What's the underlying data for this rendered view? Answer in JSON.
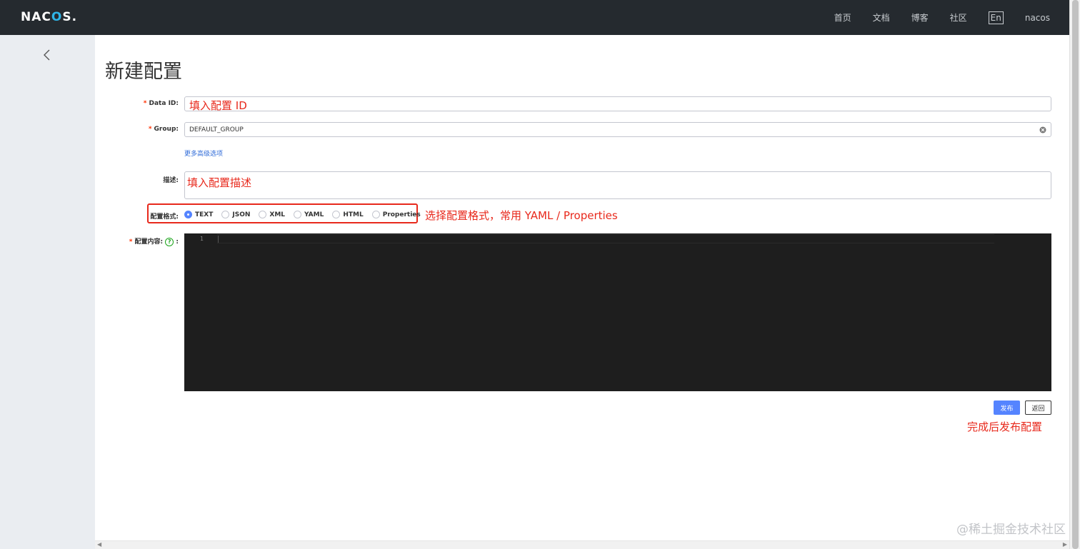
{
  "header": {
    "logo_text_a": "NAC",
    "logo_text_o": "O",
    "logo_text_b": "S.",
    "nav": [
      "首页",
      "文档",
      "博客",
      "社区"
    ],
    "lang": "En",
    "user": "nacos"
  },
  "sidebar": {
    "back_icon": "chevron-left-icon"
  },
  "page": {
    "title": "新建配置"
  },
  "form": {
    "data_id": {
      "label": "Data ID:",
      "value": "填入配置 ID"
    },
    "group": {
      "label": "Group:",
      "value": "DEFAULT_GROUP"
    },
    "more_options": "更多高级选项",
    "description": {
      "label": "描述:",
      "value": "填入配置描述"
    },
    "format": {
      "label": "配置格式:",
      "options": [
        "TEXT",
        "JSON",
        "XML",
        "YAML",
        "HTML",
        "Properties"
      ],
      "selected": "TEXT",
      "annotation": "选择配置格式，常用 YAML / Properties"
    },
    "content": {
      "label": "配置内容:",
      "help": "?",
      "colon": ":",
      "line_number": "1"
    }
  },
  "actions": {
    "publish": "发布",
    "back": "返回",
    "annotation": "完成后发布配置"
  },
  "watermark": "@稀土掘金技术社区",
  "colors": {
    "accent": "#5584ff",
    "annotation": "#e8291c",
    "header_bg": "#252a2f"
  }
}
